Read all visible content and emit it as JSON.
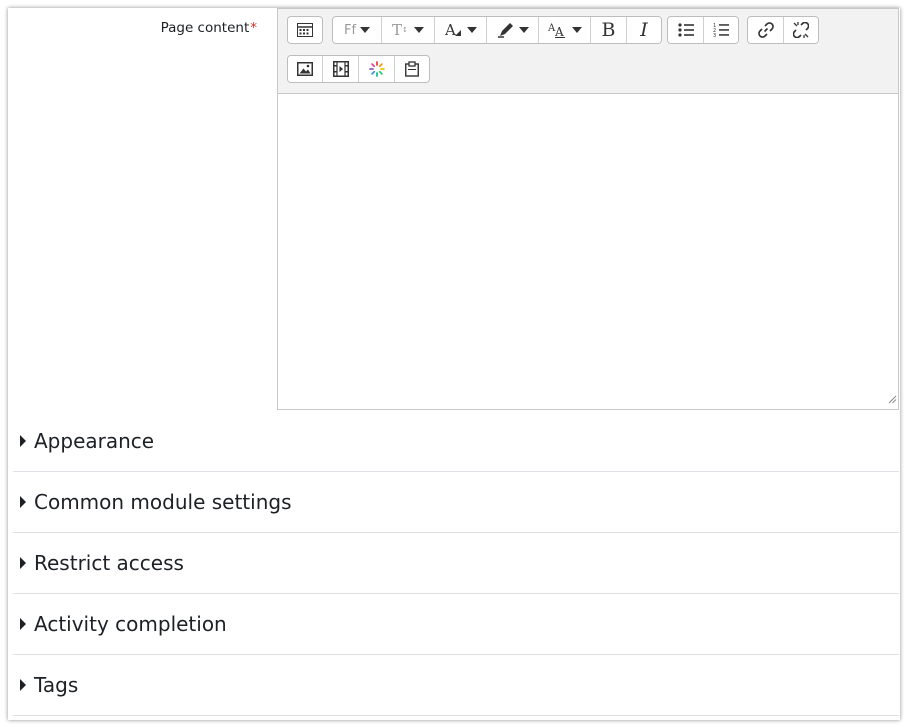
{
  "form": {
    "label": "Page content",
    "required_marker": "*"
  },
  "toolbar": {
    "buttons": {
      "toggle": "show-more-buttons-icon",
      "font_family": "Ff",
      "font_size": "font-size-icon",
      "font_color": "font-color-icon",
      "highlight": "highlight-icon",
      "style": "paragraph-style-icon",
      "bold": "B",
      "italic": "I",
      "unordered_list": "unordered-list-icon",
      "ordered_list": "ordered-list-icon",
      "link": "link-icon",
      "unlink": "unlink-icon",
      "image": "image-icon",
      "media": "media-icon",
      "h5p": "h5p-icon",
      "paste": "paste-icon"
    }
  },
  "sections": [
    {
      "title": "Appearance"
    },
    {
      "title": "Common module settings"
    },
    {
      "title": "Restrict access"
    },
    {
      "title": "Activity completion"
    },
    {
      "title": "Tags"
    }
  ]
}
